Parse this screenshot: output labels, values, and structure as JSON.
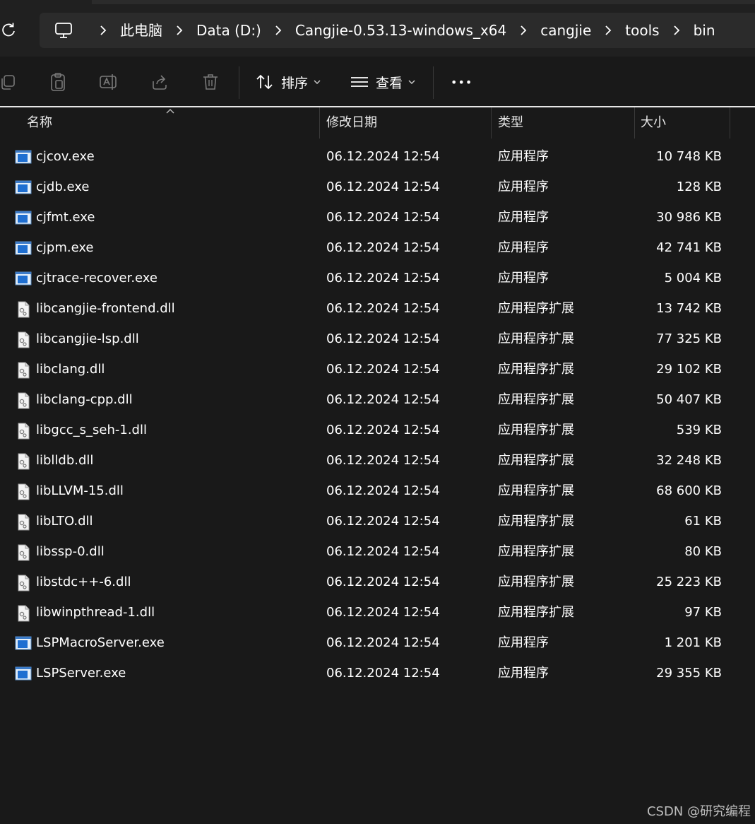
{
  "breadcrumb": {
    "items": [
      "此电脑",
      "Data (D:)",
      "Cangjie-0.53.13-windows_x64",
      "cangjie",
      "tools",
      "bin"
    ]
  },
  "toolbar": {
    "sort_label": "排序",
    "view_label": "查看",
    "more_label": "•••"
  },
  "columns": {
    "name": "名称",
    "modified": "修改日期",
    "type": "类型",
    "size": "大小"
  },
  "files": [
    {
      "name": "cjcov.exe",
      "modified": "06.12.2024 12:54",
      "type": "应用程序",
      "size": "10 748 KB",
      "icon": "exe-icon"
    },
    {
      "name": "cjdb.exe",
      "modified": "06.12.2024 12:54",
      "type": "应用程序",
      "size": "128 KB",
      "icon": "exe-icon"
    },
    {
      "name": "cjfmt.exe",
      "modified": "06.12.2024 12:54",
      "type": "应用程序",
      "size": "30 986 KB",
      "icon": "exe-icon"
    },
    {
      "name": "cjpm.exe",
      "modified": "06.12.2024 12:54",
      "type": "应用程序",
      "size": "42 741 KB",
      "icon": "exe-icon"
    },
    {
      "name": "cjtrace-recover.exe",
      "modified": "06.12.2024 12:54",
      "type": "应用程序",
      "size": "5 004 KB",
      "icon": "exe-icon"
    },
    {
      "name": "libcangjie-frontend.dll",
      "modified": "06.12.2024 12:54",
      "type": "应用程序扩展",
      "size": "13 742 KB",
      "icon": "dll-icon"
    },
    {
      "name": "libcangjie-lsp.dll",
      "modified": "06.12.2024 12:54",
      "type": "应用程序扩展",
      "size": "77 325 KB",
      "icon": "dll-icon"
    },
    {
      "name": "libclang.dll",
      "modified": "06.12.2024 12:54",
      "type": "应用程序扩展",
      "size": "29 102 KB",
      "icon": "dll-icon"
    },
    {
      "name": "libclang-cpp.dll",
      "modified": "06.12.2024 12:54",
      "type": "应用程序扩展",
      "size": "50 407 KB",
      "icon": "dll-icon"
    },
    {
      "name": "libgcc_s_seh-1.dll",
      "modified": "06.12.2024 12:54",
      "type": "应用程序扩展",
      "size": "539 KB",
      "icon": "dll-icon"
    },
    {
      "name": "liblldb.dll",
      "modified": "06.12.2024 12:54",
      "type": "应用程序扩展",
      "size": "32 248 KB",
      "icon": "dll-icon"
    },
    {
      "name": "libLLVM-15.dll",
      "modified": "06.12.2024 12:54",
      "type": "应用程序扩展",
      "size": "68 600 KB",
      "icon": "dll-icon"
    },
    {
      "name": "libLTO.dll",
      "modified": "06.12.2024 12:54",
      "type": "应用程序扩展",
      "size": "61 KB",
      "icon": "dll-icon"
    },
    {
      "name": "libssp-0.dll",
      "modified": "06.12.2024 12:54",
      "type": "应用程序扩展",
      "size": "80 KB",
      "icon": "dll-icon"
    },
    {
      "name": "libstdc++-6.dll",
      "modified": "06.12.2024 12:54",
      "type": "应用程序扩展",
      "size": "25 223 KB",
      "icon": "dll-icon"
    },
    {
      "name": "libwinpthread-1.dll",
      "modified": "06.12.2024 12:54",
      "type": "应用程序扩展",
      "size": "97 KB",
      "icon": "dll-icon"
    },
    {
      "name": "LSPMacroServer.exe",
      "modified": "06.12.2024 12:54",
      "type": "应用程序",
      "size": "1 201 KB",
      "icon": "exe-icon"
    },
    {
      "name": "LSPServer.exe",
      "modified": "06.12.2024 12:54",
      "type": "应用程序",
      "size": "29 355 KB",
      "icon": "exe-icon"
    }
  ],
  "watermark": "CSDN @研究编程"
}
